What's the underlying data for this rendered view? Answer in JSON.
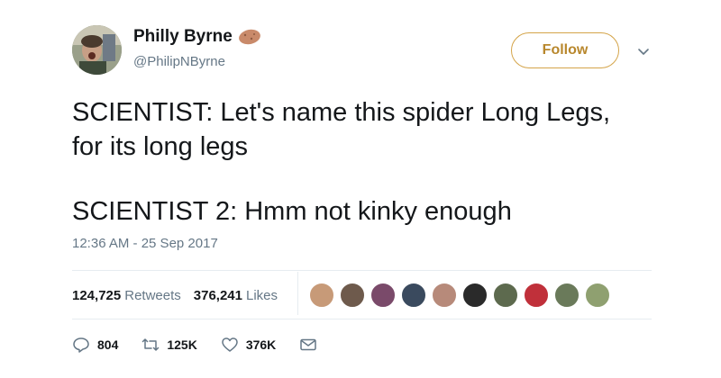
{
  "tweet": {
    "author": {
      "display_name": "Philly Byrne",
      "handle": "@PhilipNByrne"
    },
    "follow_label": "Follow",
    "text_lines": [
      "SCIENTIST: Let's name this spider Long Legs,",
      "for its long legs",
      "SCIENTIST 2: Hmm not kinky enough"
    ],
    "timestamp": "12:36 AM - 25 Sep 2017",
    "stats": {
      "retweets_count": "124,725",
      "retweets_label": "Retweets",
      "likes_count": "376,241",
      "likes_label": "Likes"
    },
    "liker_avatar_colors": [
      "#c79a78",
      "#6e5a4c",
      "#7a4a6a",
      "#3a4a5e",
      "#b78a7a",
      "#2a2a2a",
      "#5d6a4e",
      "#c0303a",
      "#6a7a5a",
      "#8fa070"
    ],
    "actions": {
      "reply_count": "804",
      "retweet_count": "125K",
      "like_count": "376K"
    },
    "colors": {
      "follow_border": "#d4a449",
      "follow_text": "#b8872c",
      "secondary_text": "#657786"
    },
    "icons": [
      "potato-emoji-icon",
      "chevron-down-icon",
      "reply-icon",
      "retweet-icon",
      "heart-icon",
      "envelope-icon"
    ]
  }
}
